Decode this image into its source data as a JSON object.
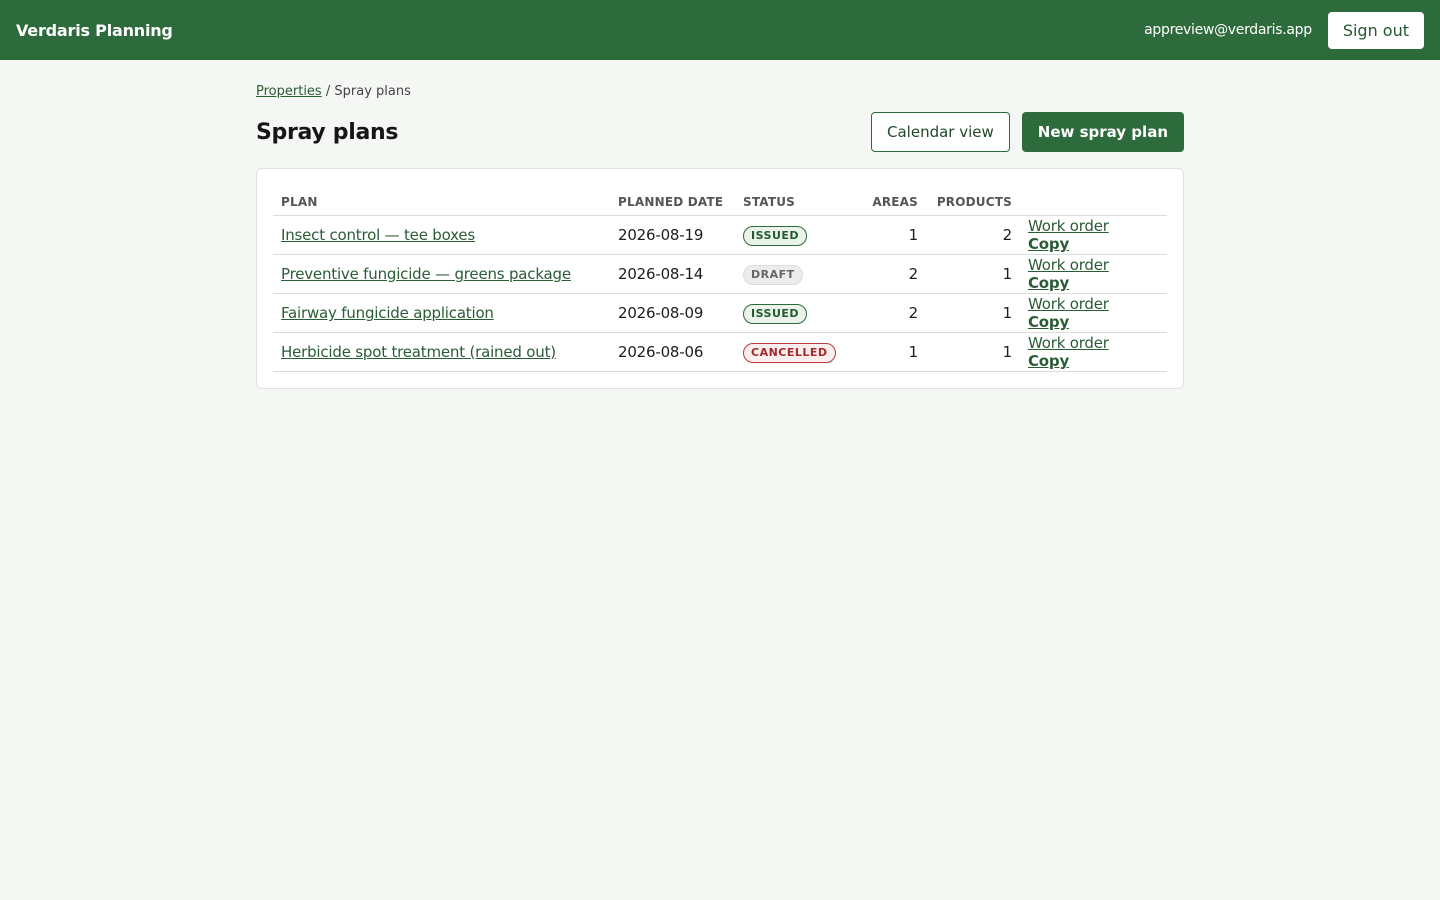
{
  "app": {
    "brand": "Verdaris Planning",
    "user_email": "appreview@verdaris.app",
    "signout_label": "Sign out"
  },
  "breadcrumb": {
    "parent": "Properties",
    "separator": "/",
    "current": "Spray plans"
  },
  "page": {
    "title": "Spray plans",
    "calendar_label": "Calendar view",
    "new_label": "New spray plan"
  },
  "table": {
    "headers": {
      "plan": "Plan",
      "date": "Planned date",
      "status": "Status",
      "areas": "Areas",
      "products": "Products"
    },
    "rows": [
      {
        "plan": "Insect control — tee boxes",
        "date": "2026-08-19",
        "status": "ISSUED",
        "status_kind": "issued",
        "areas": "1",
        "products": "2",
        "work_order": "Work order",
        "copy": "Copy"
      },
      {
        "plan": "Preventive fungicide — greens package",
        "date": "2026-08-14",
        "status": "DRAFT",
        "status_kind": "draft",
        "areas": "2",
        "products": "1",
        "work_order": "Work order",
        "copy": "Copy"
      },
      {
        "plan": "Fairway fungicide application",
        "date": "2026-08-09",
        "status": "ISSUED",
        "status_kind": "issued",
        "areas": "2",
        "products": "1",
        "work_order": "Work order",
        "copy": "Copy"
      },
      {
        "plan": "Herbicide spot treatment (rained out)",
        "date": "2026-08-06",
        "status": "CANCELLED",
        "status_kind": "cancelled",
        "areas": "1",
        "products": "1",
        "work_order": "Work order",
        "copy": "Copy"
      }
    ]
  },
  "colors": {
    "brand_green": "#2e6b3c",
    "issued": "#2e6b3c",
    "draft": "#666666",
    "cancelled": "#a52a2a"
  }
}
